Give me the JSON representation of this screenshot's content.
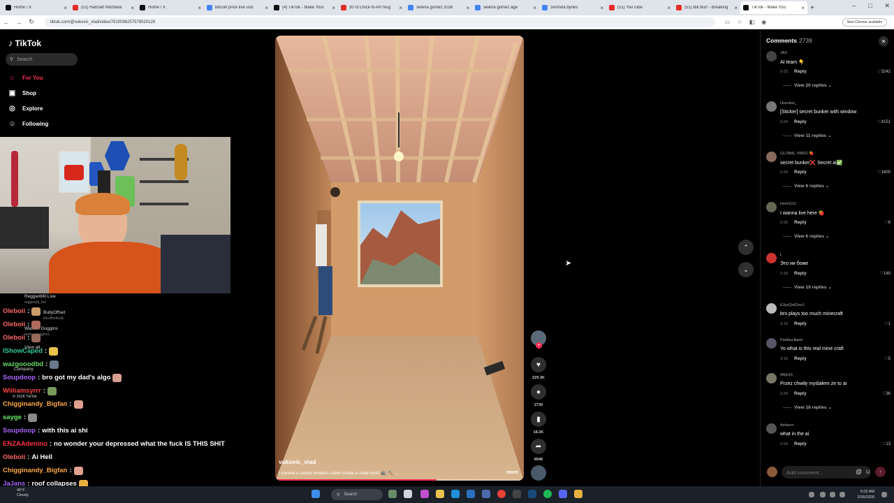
{
  "browser": {
    "tabs": [
      {
        "title": "Home / X",
        "color": "#111111"
      },
      {
        "title": "(51) Hannah Montana",
        "color": "#e52d27"
      },
      {
        "title": "Home / X",
        "color": "#111111"
      },
      {
        "title": "bitcoin price live usd",
        "color": "#4285f4"
      },
      {
        "title": "(4) TikTok - Make Your",
        "color": "#111111"
      },
      {
        "title": "30 ct Chick-fil-A® Nug",
        "color": "#e52d27"
      },
      {
        "title": "selena gomez 2026",
        "color": "#4285f4"
      },
      {
        "title": "selena gomez age",
        "color": "#4285f4"
      },
      {
        "title": "zerenda bynes",
        "color": "#4285f4"
      },
      {
        "title": "(51) YouTube",
        "color": "#e52d27"
      },
      {
        "title": "(51) Bill Burr - Breaking",
        "color": "#e52d27"
      },
      {
        "title": "TikTok - Make You",
        "color": "#111111",
        "active": true
      }
    ],
    "url": "tiktok.com/@vukovic_vlad/video/7610096257578020129",
    "chrome_button": "New Chrome available"
  },
  "tiktok": {
    "logo": "TikTok",
    "search_placeholder": "Search",
    "nav": [
      {
        "label": "For You",
        "icon": "home-icon",
        "active": true
      },
      {
        "label": "Shop",
        "icon": "shop-icon"
      },
      {
        "label": "Explore",
        "icon": "compass-icon"
      },
      {
        "label": "Following",
        "icon": "following-icon"
      }
    ],
    "ghost": {
      "user1": "ReggieWill Live",
      "user1_handle": "reggiewill_live",
      "user2": "BullyOffset",
      "user2_handle": "theoffsetbully",
      "user3": "Watson Goggins",
      "user3_handle": "watsongoggins1",
      "view_all": "View all",
      "company": "Company",
      "copyright": "© 2026 TikTok"
    }
  },
  "chat": [
    {
      "user": "Oleboii",
      "color": "#ff6666",
      "text": "",
      "emote": "#c99a6a"
    },
    {
      "user": "Oleboii",
      "color": "#ff6666",
      "text": "",
      "emote": "#b06a5a"
    },
    {
      "user": "Oleboii",
      "color": "#ff6666",
      "text": "",
      "emote": "#9a6a5a"
    },
    {
      "user": "IShowCaped",
      "color": "#33cc99",
      "text": "",
      "emote": "#e8c24a"
    },
    {
      "user": "wazgooodbd",
      "color": "#66dd66",
      "text": "",
      "emote": "#6a7a8a"
    },
    {
      "user": "Soupdoop",
      "color": "#aa66ff",
      "text": "bro got my dad's algo",
      "emote": "#d8a090"
    },
    {
      "user": "Williamsyrrr",
      "color": "#ff4444",
      "text": "",
      "emote": "#7a9a5a"
    },
    {
      "user": "Chigginandy_Bigfan",
      "color": "#ffaa44",
      "text": "",
      "emote": "#e0a090"
    },
    {
      "user": "sayge",
      "color": "#66ee66",
      "text": "",
      "emote": "#8a8a8a"
    },
    {
      "user": "Soupdoop",
      "color": "#aa66ff",
      "text": "with this ai shi",
      "emote": ""
    },
    {
      "user": "ENZAAdenino",
      "color": "#ff3344",
      "text": "no wonder your depressed what the fuck IS THIS SHIT",
      "emote": ""
    },
    {
      "user": "Oleboii",
      "color": "#ff6666",
      "text": "Ai Hell",
      "emote": ""
    },
    {
      "user": "Chigginandy_Bigfan",
      "color": "#ffaa44",
      "text": "",
      "emote": "#e0a090"
    },
    {
      "user": "JaJans",
      "color": "#aa66ff",
      "text": "roof collapses",
      "emote": "#e8b040"
    }
  ],
  "video": {
    "author": "vukovic_vlad",
    "caption": "I carved a secret modern cabin inside a solid rock! 🪨 ⛏️ ...",
    "more": "more",
    "progress": 0.65
  },
  "actions": {
    "likes": "229.3K",
    "comments": "2739",
    "saves": "18.3K",
    "shares": "8948"
  },
  "comments_panel": {
    "title": "Comments",
    "count": "2739",
    "items": [
      {
        "user": "JAX",
        "text": "AI team 👇",
        "date": "2-23",
        "likes": "3242",
        "replies": "View 20 replies"
      },
      {
        "user": "Huzokss_",
        "text": "[Sticker] secret bunker with window",
        "date": "2-24",
        "likes": "4151",
        "replies": "View 11 replies"
      },
      {
        "user": "GLOBAL VIBES 🍓",
        "text": "secret bunker❌ Secret ai✅",
        "date": "2-24",
        "likes": "1600",
        "replies": "View 6 replies"
      },
      {
        "user": "Hsrini112",
        "text": "I wanna live here 🍓",
        "date": "2-25",
        "likes": "6",
        "replies": "View 6 replies"
      },
      {
        "user": "L",
        "text": "Это ии боже",
        "date": "2-23",
        "likes": "149",
        "replies": "View 19 replies"
      },
      {
        "user": "EJpzQvK2eu1",
        "text": "bro plays too much minecraft",
        "date": "3-10",
        "likes": "1",
        "replies": ""
      },
      {
        "user": "Paidayclipper",
        "text": "Yo what is this real mine craft",
        "date": "3-16",
        "likes": "5",
        "replies": ""
      },
      {
        "user": "Wiljo16",
        "text": "Przez chwilę myślałem że to ai",
        "date": "2-24",
        "likes": "36",
        "replies": "View 18 replies"
      },
      {
        "user": "Amberrr",
        "text": "what in the ai",
        "date": "2-24",
        "likes": "13",
        "replies": ""
      }
    ],
    "reply_label": "Reply",
    "add_placeholder": "Add comment..."
  },
  "taskbar": {
    "weather_temp": "45°F",
    "weather_desc": "Cloudy",
    "search": "Search",
    "time": "5:02 AM",
    "date": "2/26/2026"
  }
}
